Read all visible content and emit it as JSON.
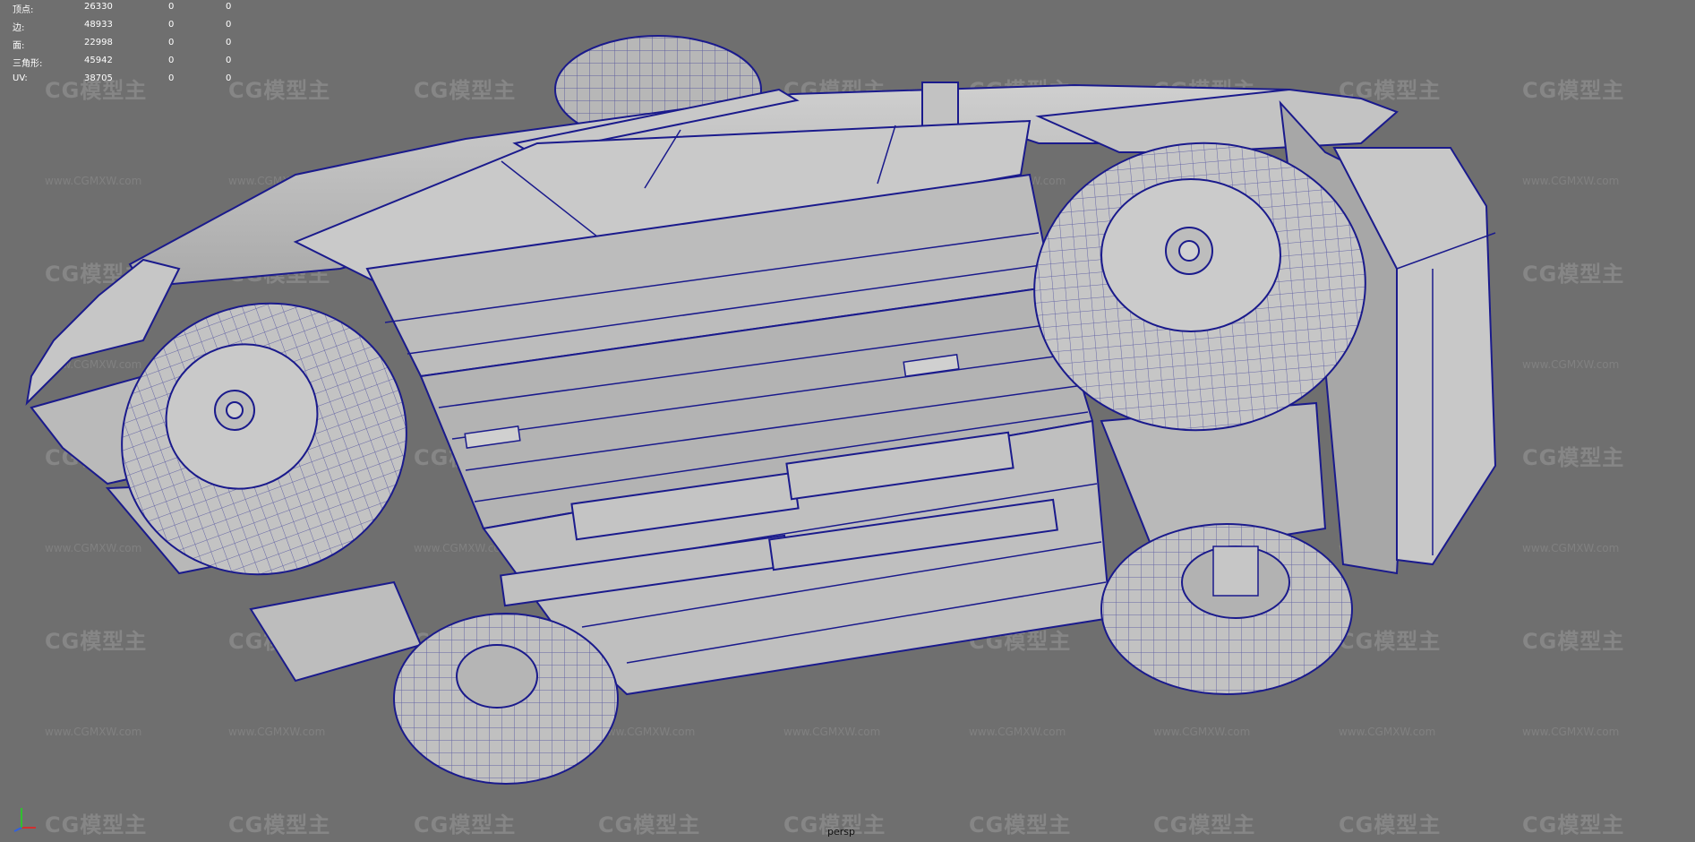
{
  "viewport": {
    "camera": "persp",
    "background": "#6f6f6f",
    "wireframe_color": "#1a1a8c",
    "model_fill": "#bdbdbd"
  },
  "stats": {
    "rows": [
      {
        "label": "顶点:",
        "value": "26330",
        "selected": "0",
        "highlighted": "0"
      },
      {
        "label": "边:",
        "value": "48933",
        "selected": "0",
        "highlighted": "0"
      },
      {
        "label": "面:",
        "value": "22998",
        "selected": "0",
        "highlighted": "0"
      },
      {
        "label": "三角形:",
        "value": "45942",
        "selected": "0",
        "highlighted": "0"
      },
      {
        "label": "UV:",
        "value": "38705",
        "selected": "0",
        "highlighted": "0"
      }
    ]
  },
  "watermark": {
    "logo_text": "CG模型主",
    "url_text": "www.CGMXW.com"
  },
  "axis_gizmo": {
    "icon": "axis-gizmo-icon",
    "x_color": "#d03030",
    "y_color": "#30c030",
    "z_color": "#3060e0"
  }
}
